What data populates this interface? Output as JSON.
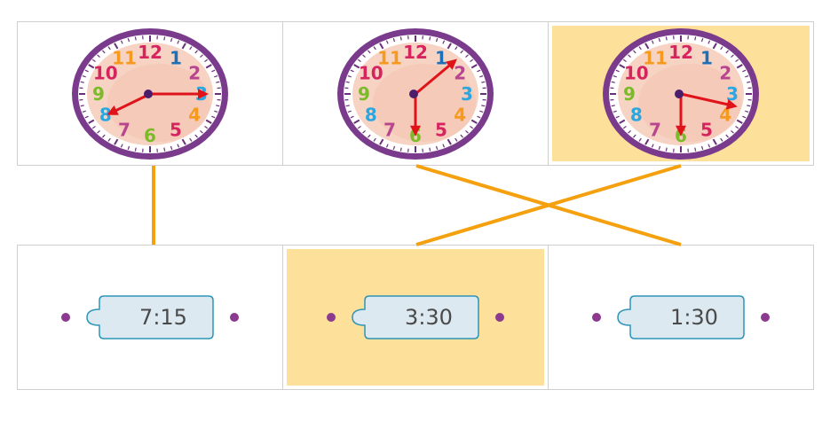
{
  "clocks": [
    {
      "id": "clock-1",
      "hour_angle": 90,
      "minute_angle": 240,
      "selected": false
    },
    {
      "id": "clock-2",
      "hour_angle": 45,
      "minute_angle": 180,
      "selected": false
    },
    {
      "id": "clock-3",
      "hour_angle": 105,
      "minute_angle": 180,
      "selected": true
    }
  ],
  "clock_numbers": [
    "12",
    "1",
    "2",
    "3",
    "4",
    "5",
    "6",
    "7",
    "8",
    "9",
    "10",
    "11"
  ],
  "clock_number_colors": [
    "#d6245f",
    "#1c70b8",
    "#b8458f",
    "#2aa7e0",
    "#f59a1e",
    "#d6245f",
    "#7bbb2a",
    "#b8458f",
    "#2aa7e0",
    "#7bbb2a",
    "#d6245f",
    "#f59a1e"
  ],
  "times": [
    {
      "label": "7:15",
      "selected": false
    },
    {
      "label": "3:30",
      "selected": true
    },
    {
      "label": "1:30",
      "selected": false
    }
  ],
  "connections": [
    {
      "from": 0,
      "to": 0
    },
    {
      "from": 1,
      "to": 2
    },
    {
      "from": 2,
      "to": 1
    }
  ],
  "colors": {
    "line": "#f5a00e",
    "selected_bg": "#fde09a",
    "tag_fill": "#dde9f1",
    "tag_border": "#2c95b7",
    "dot": "#8b3a8f",
    "hand": "#e0121a",
    "clock_ring": "#7a3b8c",
    "clock_face": "#f7d3c3"
  }
}
